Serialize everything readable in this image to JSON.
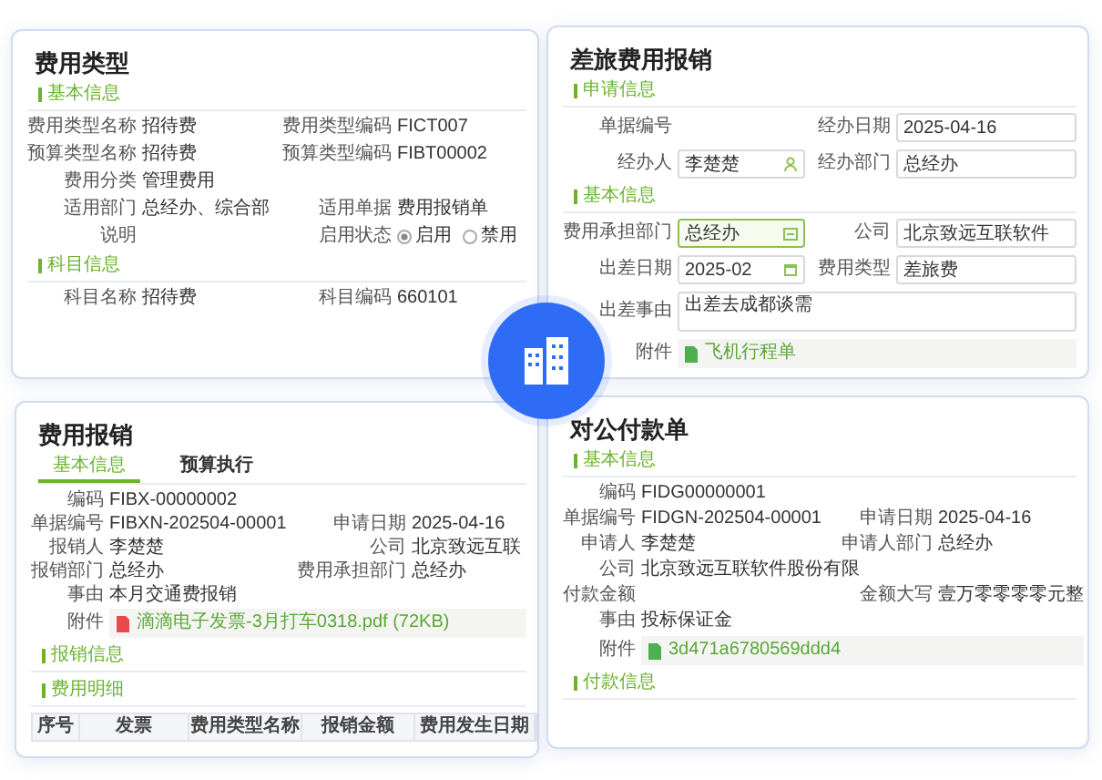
{
  "cards": [
    {
      "title": "费用类型",
      "sections": [
        {
          "heading": "基本信息",
          "rows": [
            [
              {
                "label": "费用类型名称",
                "kind": "text",
                "value": "招待费"
              },
              {
                "label": "费用类型编码",
                "kind": "text",
                "value": "FICT007"
              }
            ],
            [
              {
                "label": "预算类型名称",
                "kind": "text",
                "value": "招待费"
              },
              {
                "label": "预算类型编码",
                "kind": "text",
                "value": "FIBT00002"
              }
            ],
            [
              {
                "label": "费用分类",
                "kind": "text",
                "value": "管理费用"
              }
            ],
            [
              {
                "label": "适用部门",
                "kind": "text",
                "value": "总经办、综合部"
              },
              {
                "label": "适用单据",
                "kind": "text",
                "value": "费用报销单"
              }
            ],
            [
              {
                "label": "说明",
                "kind": "text"
              },
              {
                "label": "启用状态",
                "kind": "radio",
                "options": [
                  {
                    "label": "启用",
                    "selected": true
                  },
                  {
                    "label": "禁用",
                    "selected": false
                  }
                ]
              }
            ]
          ]
        },
        {
          "heading": "科目信息",
          "rows": [
            [
              {
                "label": "科目名称",
                "kind": "text",
                "value": "招待费"
              },
              {
                "label": "科目编码",
                "kind": "text",
                "value": "660101"
              }
            ]
          ]
        }
      ]
    },
    {
      "title": "差旅费用报销",
      "sections": [
        {
          "heading": "申请信息",
          "rows": [
            [
              {
                "label": "单据编号",
                "kind": "text"
              },
              {
                "label": "经办日期",
                "kind": "input",
                "value": "2025-04-16",
                "focused": false
              }
            ],
            [
              {
                "label": "经办人",
                "kind": "person",
                "value": "李楚楚",
                "focused": false
              },
              {
                "label": "经办部门",
                "kind": "input",
                "value": "总经办",
                "focused": false
              }
            ]
          ]
        },
        {
          "heading": "基本信息",
          "rows": [
            [
              {
                "label": "费用承担部门",
                "kind": "picker",
                "value": "总经办",
                "focused": true
              },
              {
                "label": "公司",
                "kind": "input",
                "value": "北京致远互联软件",
                "focused": false
              }
            ],
            [
              {
                "label": "出差日期",
                "kind": "date",
                "value": "2025-02",
                "focused": false
              },
              {
                "label": "费用类型",
                "kind": "input",
                "value": "差旅费",
                "focused": false
              }
            ],
            [
              {
                "label": "出差事由",
                "kind": "textarea",
                "value": "出差去成都谈需"
              }
            ],
            [
              {
                "label": "附件",
                "kind": "file",
                "value": "飞机行程单"
              }
            ]
          ]
        }
      ]
    },
    {
      "title": "费用报销",
      "tabs": [
        {
          "label": "基本信息",
          "selected": true
        },
        {
          "label": "预算执行",
          "selected": false
        }
      ],
      "sections": [
        {
          "rows": [
            [
              {
                "label": "编码",
                "kind": "text",
                "value": "FIBX-00000002"
              }
            ],
            [
              {
                "label": "单据编号",
                "kind": "text",
                "value": "FIBXN-202504-00001"
              },
              {
                "label": "申请日期",
                "kind": "text",
                "value": "2025-04-16"
              }
            ],
            [
              {
                "label": "报销人",
                "kind": "text",
                "value": "李楚楚"
              },
              {
                "label": "公司",
                "kind": "text",
                "value": "北京致远互联"
              }
            ],
            [
              {
                "label": "报销部门",
                "kind": "text",
                "value": "总经办"
              },
              {
                "label": "费用承担部门",
                "kind": "text",
                "value": "总经办"
              }
            ],
            [
              {
                "label": "事由",
                "kind": "text",
                "value": "本月交通费报销"
              }
            ],
            [
              {
                "label": "附件",
                "kind": "pdf",
                "value": "滴滴电子发票-3月打车0318.pdf (72KB)"
              }
            ]
          ]
        },
        {
          "heading": "报销信息"
        },
        {
          "heading": "费用明细",
          "table": {
            "columns": [
              "序号",
              "发票",
              "费用类型名称",
              "报销金额",
              "费用发生日期"
            ]
          }
        }
      ]
    },
    {
      "title": "对公付款单",
      "sections": [
        {
          "heading": "基本信息",
          "rows": [
            [
              {
                "label": "编码",
                "kind": "text",
                "value": "FIDG00000001"
              }
            ],
            [
              {
                "label": "单据编号",
                "kind": "text",
                "value": "FIDGN-202504-00001"
              },
              {
                "label": "申请日期",
                "kind": "text",
                "value": "2025-04-16"
              }
            ],
            [
              {
                "label": "申请人",
                "kind": "text",
                "value": "李楚楚"
              },
              {
                "label": "申请人部门",
                "kind": "text",
                "value": "总经办"
              }
            ],
            [
              {
                "label": "公司",
                "kind": "text",
                "value": "北京致远互联软件股份有限"
              }
            ],
            [
              {
                "label": "付款金额",
                "kind": "text"
              },
              {
                "label": "金额大写",
                "kind": "text",
                "value": "壹万零零零零元整"
              }
            ],
            [
              {
                "label": "事由",
                "kind": "text",
                "value": "投标保证金"
              }
            ],
            [
              {
                "label": "附件",
                "kind": "file",
                "value": "3d471a6780569ddd4"
              }
            ]
          ]
        },
        {
          "heading": "付款信息"
        }
      ]
    }
  ]
}
